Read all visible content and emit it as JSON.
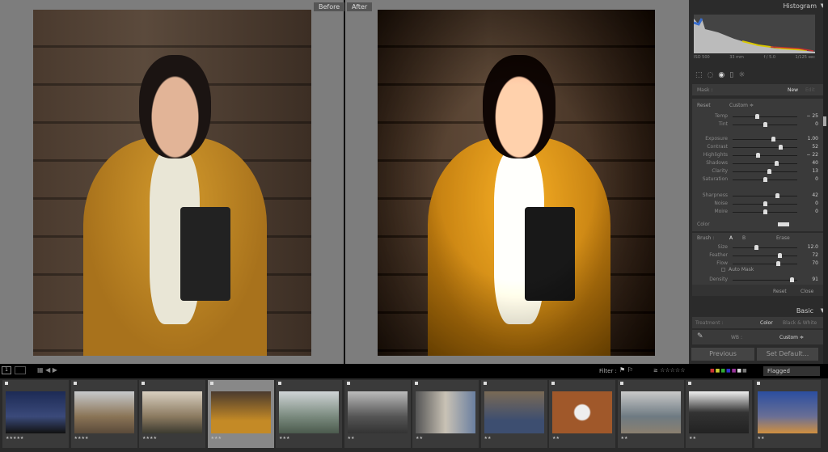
{
  "views": {
    "before_label": "Before",
    "after_label": "After"
  },
  "histogram": {
    "title": "Histogram",
    "iso": "ISO 500",
    "focal": "33 mm",
    "aperture": "f / 5.0",
    "shutter": "1/125 sec"
  },
  "mask": {
    "label": "Mask :",
    "new": "New",
    "edit": "Edit"
  },
  "effect": {
    "reset": "Reset",
    "preset": "Custom ≑",
    "sliders": [
      {
        "name": "Temp",
        "value": "− 25",
        "pos": 0.38
      },
      {
        "name": "Tint",
        "value": "0",
        "pos": 0.5
      },
      {
        "name": "Exposure",
        "value": "1.00",
        "pos": 0.62
      },
      {
        "name": "Contrast",
        "value": "52",
        "pos": 0.74
      },
      {
        "name": "Highlights",
        "value": "− 22",
        "pos": 0.39
      },
      {
        "name": "Shadows",
        "value": "40",
        "pos": 0.68
      },
      {
        "name": "Clarity",
        "value": "13",
        "pos": 0.56
      },
      {
        "name": "Saturation",
        "value": "0",
        "pos": 0.5
      },
      {
        "name": "Sharpness",
        "value": "42",
        "pos": 0.69
      },
      {
        "name": "Noise",
        "value": "0",
        "pos": 0.5
      },
      {
        "name": "Moire",
        "value": "0",
        "pos": 0.5
      }
    ],
    "color_label": "Color"
  },
  "brush": {
    "label": "Brush :",
    "a": "A",
    "b": "B",
    "erase": "Erase",
    "sliders": [
      {
        "name": "Size",
        "value": "12.0",
        "pos": 0.36
      },
      {
        "name": "Feather",
        "value": "72",
        "pos": 0.72
      },
      {
        "name": "Flow",
        "value": "70",
        "pos": 0.7
      },
      {
        "name": "Density",
        "value": "91",
        "pos": 0.91
      }
    ],
    "auto_mask": "Auto Mask",
    "reset": "Reset",
    "close": "Close"
  },
  "basic": {
    "title": "Basic",
    "treatment": "Treatment :",
    "color": "Color",
    "bw": "Black & White",
    "wb": "WB :",
    "wb_value": "Custom ≑"
  },
  "buttons": {
    "previous": "Previous",
    "set_default": "Set Default..."
  },
  "filter": {
    "label": "Filter :",
    "rating": "≥ ☆☆☆☆☆",
    "flagged": "Flagged"
  },
  "filmstrip": [
    {
      "stars": "★★★★★",
      "bg": "linear-gradient(180deg,#1c2a55,#3b4a7a 60%,#111)"
    },
    {
      "stars": "★★★★",
      "bg": "linear-gradient(180deg,#c7c9cc,#8a7456 60%,#5a4a3a)"
    },
    {
      "stars": "★★★★",
      "bg": "linear-gradient(180deg,#d8cfc0,#8b7a60 60%,#3c3a30)"
    },
    {
      "stars": "★★★",
      "bg": "linear-gradient(180deg,#4a3a2e,#c48a26 70%)",
      "selected": true
    },
    {
      "stars": "★★★",
      "bg": "linear-gradient(180deg,#cfd4d6,#7a8a7e 60%,#4b5a4d)"
    },
    {
      "stars": "★★",
      "bg": "linear-gradient(180deg,#bbb,#555 60%,#333)"
    },
    {
      "stars": "★★",
      "bg": "linear-gradient(90deg,#555,#c9c2b5,#6a7fa0)"
    },
    {
      "stars": "★★",
      "bg": "linear-gradient(180deg,#7a6a55,#3d4e70 70%)"
    },
    {
      "stars": "★★",
      "bg": "radial-gradient(circle,#eee 20%,#a0582a 24%)"
    },
    {
      "stars": "★★",
      "bg": "linear-gradient(180deg,#c9c9c9,#6e7a82 60%,#8b8070)"
    },
    {
      "stars": "★★",
      "bg": "linear-gradient(180deg,#eee,#333 50%,#222)"
    },
    {
      "stars": "★★",
      "bg": "linear-gradient(180deg,#2b4ea0,#6a6f95 60%,#d09040)"
    }
  ]
}
